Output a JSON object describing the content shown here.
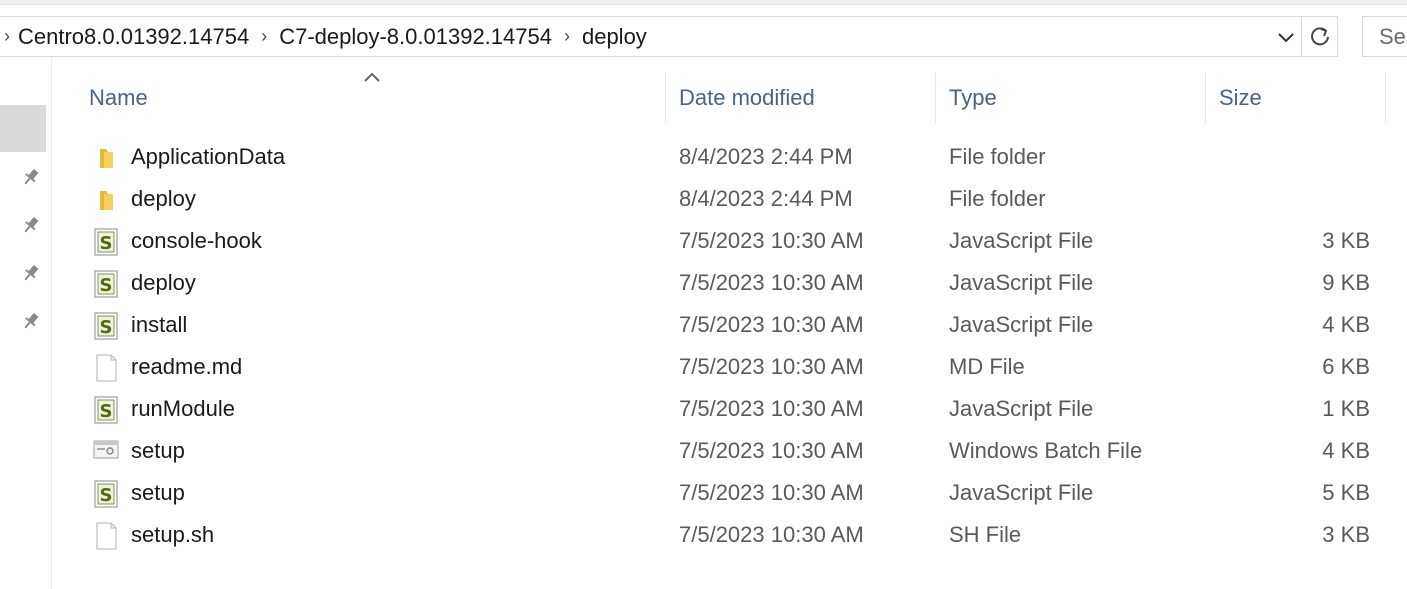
{
  "breadcrumb": {
    "items": [
      "Centro8.0.01392.14754",
      "C7-deploy-8.0.01392.14754",
      "deploy"
    ]
  },
  "search": {
    "placeholder": "Sea"
  },
  "columns": {
    "name": "Name",
    "date": "Date modified",
    "type": "Type",
    "size": "Size"
  },
  "files": [
    {
      "name": "ApplicationData",
      "date": "8/4/2023 2:44 PM",
      "type": "File folder",
      "size": "",
      "icon": "folder-icon"
    },
    {
      "name": "deploy",
      "date": "8/4/2023 2:44 PM",
      "type": "File folder",
      "size": "",
      "icon": "folder-icon"
    },
    {
      "name": "console-hook",
      "date": "7/5/2023 10:30 AM",
      "type": "JavaScript File",
      "size": "3 KB",
      "icon": "javascript-file-icon"
    },
    {
      "name": "deploy",
      "date": "7/5/2023 10:30 AM",
      "type": "JavaScript File",
      "size": "9 KB",
      "icon": "javascript-file-icon"
    },
    {
      "name": "install",
      "date": "7/5/2023 10:30 AM",
      "type": "JavaScript File",
      "size": "4 KB",
      "icon": "javascript-file-icon"
    },
    {
      "name": "readme.md",
      "date": "7/5/2023 10:30 AM",
      "type": "MD File",
      "size": "6 KB",
      "icon": "blank-file-icon"
    },
    {
      "name": "runModule",
      "date": "7/5/2023 10:30 AM",
      "type": "JavaScript File",
      "size": "1 KB",
      "icon": "javascript-file-icon"
    },
    {
      "name": "setup",
      "date": "7/5/2023 10:30 AM",
      "type": "Windows Batch File",
      "size": "4 KB",
      "icon": "batch-file-icon"
    },
    {
      "name": "setup",
      "date": "7/5/2023 10:30 AM",
      "type": "JavaScript File",
      "size": "5 KB",
      "icon": "javascript-file-icon"
    },
    {
      "name": "setup.sh",
      "date": "7/5/2023 10:30 AM",
      "type": "SH File",
      "size": "3 KB",
      "icon": "blank-file-icon"
    }
  ],
  "colors": {
    "header_text": "#4d6288",
    "folder": "#f3c14b",
    "nav_selected": "#dadada"
  }
}
